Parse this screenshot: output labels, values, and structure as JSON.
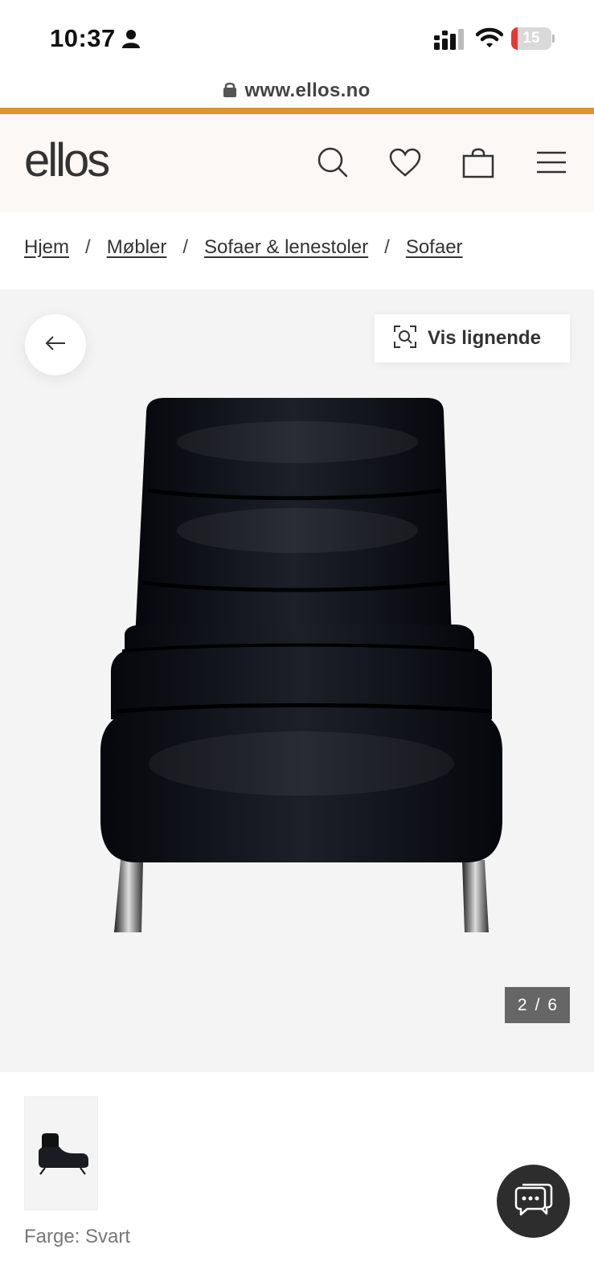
{
  "status_bar": {
    "time": "10:37",
    "battery": "15",
    "battery_level": 0.15,
    "icons": [
      "person-icon",
      "signal-icon",
      "wifi-icon",
      "battery-icon"
    ]
  },
  "browser": {
    "url": "www.ellos.no"
  },
  "header": {
    "logo": "ellos",
    "icons": [
      "search-icon",
      "heart-icon",
      "shopping-bag-icon",
      "menu-icon"
    ],
    "accent_color": "#df9133"
  },
  "breadcrumb": {
    "items": [
      "Hjem",
      "Møbler",
      "Sofaer & lenestoler",
      "Sofaer"
    ],
    "separator": "/"
  },
  "gallery": {
    "similar_label": "Vis lignende",
    "current": "2",
    "separator": "/",
    "total": "6"
  },
  "product": {
    "color_label": "Farge: Svart"
  }
}
